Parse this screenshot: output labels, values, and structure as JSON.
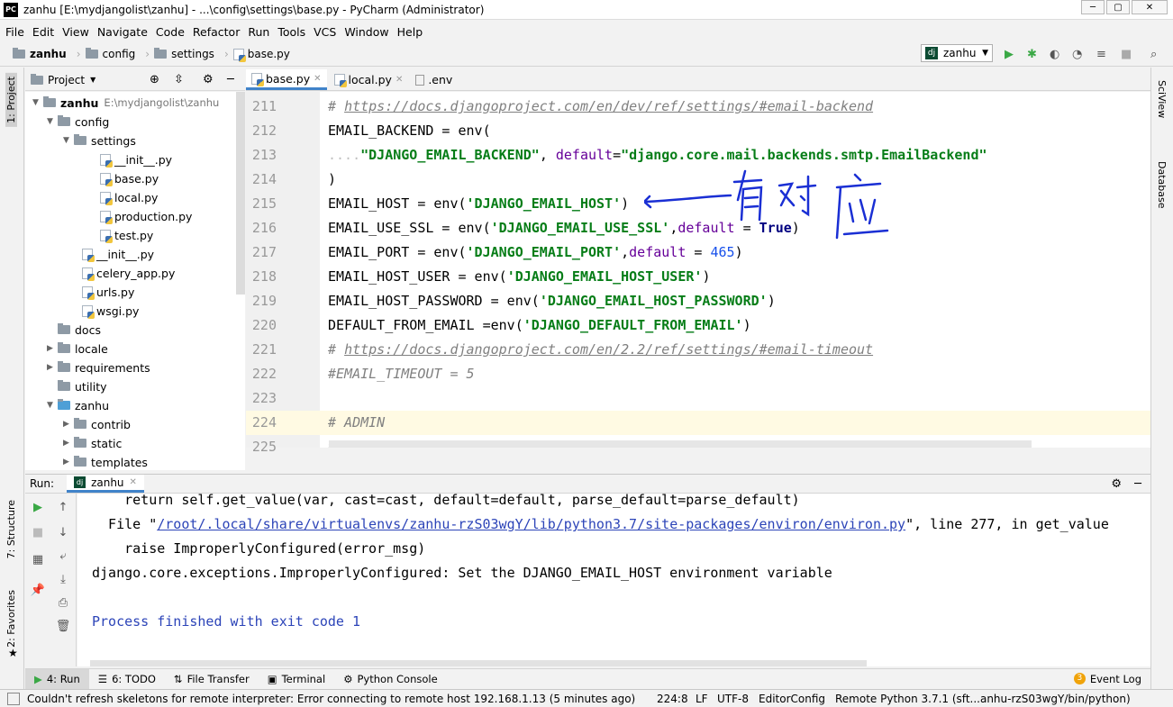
{
  "window": {
    "title": "zanhu [E:\\mydjangolist\\zanhu] - ...\\config\\settings\\base.py - PyCharm (Administrator)",
    "logo": "PC"
  },
  "menu": [
    "File",
    "Edit",
    "View",
    "Navigate",
    "Code",
    "Refactor",
    "Run",
    "Tools",
    "VCS",
    "Window",
    "Help"
  ],
  "breadcrumb": [
    "zanhu",
    "config",
    "settings",
    "base.py"
  ],
  "run_config": "zanhu",
  "left_strip": {
    "project": "1: Project",
    "structure": "7: Structure",
    "favorites": "2: Favorites"
  },
  "right_strip": {
    "sciview": "SciView",
    "database": "Database"
  },
  "project_panel": {
    "title": "Project",
    "tree": [
      {
        "label": "zanhu",
        "extra": "E:\\mydjangolist\\zanhu",
        "type": "folder",
        "bold": true
      },
      {
        "label": "config",
        "type": "folder"
      },
      {
        "label": "settings",
        "type": "folder"
      },
      {
        "label": "__init__.py",
        "type": "py"
      },
      {
        "label": "base.py",
        "type": "py"
      },
      {
        "label": "local.py",
        "type": "py"
      },
      {
        "label": "production.py",
        "type": "py"
      },
      {
        "label": "test.py",
        "type": "py"
      },
      {
        "label": "__init__.py",
        "type": "py"
      },
      {
        "label": "celery_app.py",
        "type": "py"
      },
      {
        "label": "urls.py",
        "type": "py"
      },
      {
        "label": "wsgi.py",
        "type": "py"
      },
      {
        "label": "docs",
        "type": "folder"
      },
      {
        "label": "locale",
        "type": "folder"
      },
      {
        "label": "requirements",
        "type": "folder"
      },
      {
        "label": "utility",
        "type": "folder"
      },
      {
        "label": "zanhu",
        "type": "folder"
      },
      {
        "label": "contrib",
        "type": "folder"
      },
      {
        "label": "static",
        "type": "folder"
      },
      {
        "label": "templates",
        "type": "folder"
      }
    ]
  },
  "tabs": [
    {
      "label": "base.py",
      "active": true
    },
    {
      "label": "local.py",
      "active": false
    },
    {
      "label": ".env",
      "active": false
    }
  ],
  "editor": {
    "line_numbers": [
      "211",
      "212",
      "213",
      "214",
      "215",
      "216",
      "217",
      "218",
      "219",
      "220",
      "221",
      "222",
      "223",
      "224",
      "225"
    ],
    "l211": {
      "hash": "# ",
      "url": "https://docs.djangoproject.com/en/dev/ref/settings/#email-backend"
    },
    "l212": "EMAIL_BACKEND = env(",
    "l213": {
      "dots": "....",
      "s1": "\"DJANGO_EMAIL_BACKEND\"",
      "comma": ", ",
      "kw": "default",
      "eq": "=",
      "s2": "\"django.core.mail.backends.smtp.EmailBackend\""
    },
    "l214": ")",
    "l215": {
      "pre": "EMAIL_HOST = env(",
      "s": "'DJANGO_EMAIL_HOST'",
      "post": ")"
    },
    "l216": {
      "pre": "EMAIL_USE_SSL = env(",
      "s": "'DJANGO_EMAIL_USE_SSL'",
      "comma": ",",
      "kw": "default",
      "eq": " = ",
      "v": "True",
      "post": ")"
    },
    "l217": {
      "pre": "EMAIL_PORT = env(",
      "s": "'DJANGO_EMAIL_PORT'",
      "comma": ",",
      "kw": "default",
      "eq": " = ",
      "v": "465",
      "post": ")"
    },
    "l218": {
      "pre": "EMAIL_HOST_USER = env(",
      "s": "'DJANGO_EMAIL_HOST_USER'",
      "post": ")"
    },
    "l219": {
      "pre": "EMAIL_HOST_PASSWORD = env(",
      "s": "'DJANGO_EMAIL_HOST_PASSWORD'",
      "post": ")"
    },
    "l220": {
      "pre": "DEFAULT_FROM_EMAIL =env(",
      "s": "'DJANGO_DEFAULT_FROM_EMAIL'",
      "post": ")"
    },
    "l221": {
      "hash": "# ",
      "url": "https://docs.djangoproject.com/en/2.2/ref/settings/#email-timeout"
    },
    "l222": "#EMAIL_TIMEOUT = 5",
    "l223": "",
    "l224": "# ADMIN",
    "l225": "# ------------------------------------------------------------------------------",
    "annotation": "有对应",
    "annotation_color": "#1a2fd4"
  },
  "run_panel": {
    "label": "Run:",
    "tab": "zanhu",
    "lines": {
      "c1": "    return self.get_value(var, cast=cast, default=default, parse_default=parse_default)",
      "c2_pre": "  File \"",
      "c2_link": "/root/.local/share/virtualenvs/zanhu-rzS03wgY/lib/python3.7/site-packages/environ/environ.py",
      "c2_post": "\", line 277, in get_value",
      "c3": "    raise ImproperlyConfigured(error_msg)",
      "c4": "django.core.exceptions.ImproperlyConfigured: Set the DJANGO_EMAIL_HOST environment variable",
      "c5": "Process finished with exit code 1"
    }
  },
  "bottom_tabs": [
    "4: Run",
    "6: TODO",
    "File Transfer",
    "Terminal",
    "Python Console"
  ],
  "event_log": {
    "count": "3",
    "label": "Event Log"
  },
  "status_bar": {
    "message": "Couldn't refresh skeletons for remote interpreter: Error connecting to remote host 192.168.1.13 (5 minutes ago)",
    "position": "224:8",
    "line_sep": "LF",
    "encoding": "UTF-8",
    "config": "EditorConfig",
    "interpreter": "Remote Python 3.7.1 (sft...anhu-rzS03wgY/bin/python)"
  }
}
